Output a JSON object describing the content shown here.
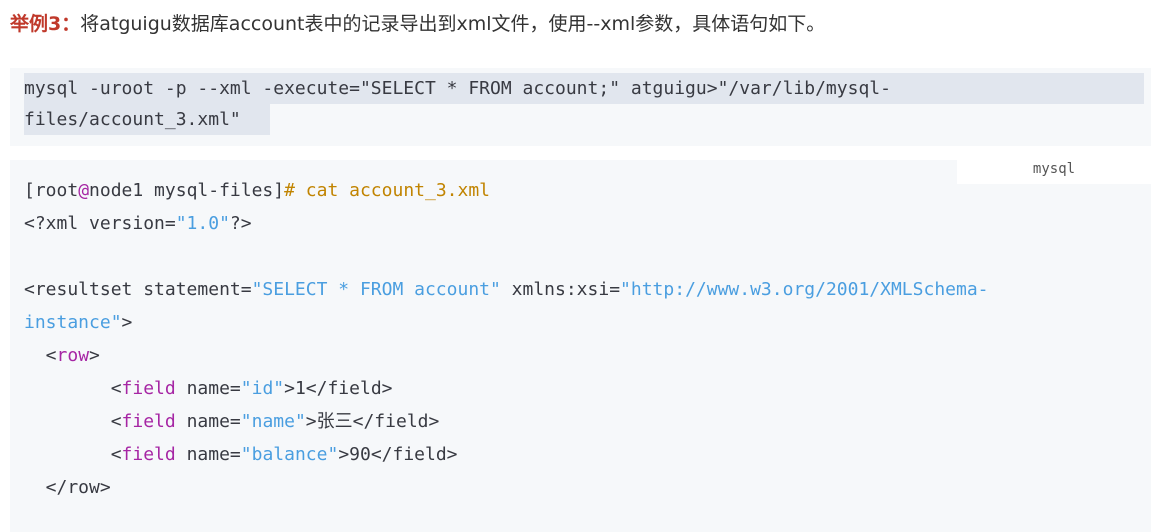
{
  "heading": {
    "label": "举例3：",
    "text": "将atguigu数据库account表中的记录导出到xml文件，使用--xml参数，具体语句如下。"
  },
  "command_block": {
    "line1": "mysql -uroot -p --xml -execute=\"SELECT * FROM account;\" atguigu>\"/var/lib/mysql-",
    "line2": "files/account_3.xml\""
  },
  "output_block": {
    "language": "mysql",
    "prompt": {
      "user": "[root",
      "at": "@",
      "host": "node1 mysql-files]",
      "sym": "#",
      "cmd": " cat account_3.xml"
    },
    "xml_decl": {
      "a": "<?xml version=",
      "b": "\"1.0\"",
      "c": "?>"
    },
    "resultset1": {
      "a": "<resultset statement=",
      "b": "\"SELECT * FROM account\"",
      "c": " xmlns:xsi=",
      "d": "\"http://www.w3.org/2001/XMLSchema-"
    },
    "resultset2": {
      "a": "instance\"",
      "b": ">"
    },
    "row_open": {
      "a": "  <",
      "b": "row",
      "c": ">"
    },
    "fields": [
      {
        "a": "        <",
        "tag": "field",
        "attr": " name=",
        "val": "\"id\"",
        "body": ">1</field>"
      },
      {
        "a": "        <",
        "tag": "field",
        "attr": " name=",
        "val": "\"name\"",
        "body": ">张三</field>"
      },
      {
        "a": "        <",
        "tag": "field",
        "attr": " name=",
        "val": "\"balance\"",
        "body": ">90</field>"
      }
    ],
    "row_close": "  </row>"
  }
}
